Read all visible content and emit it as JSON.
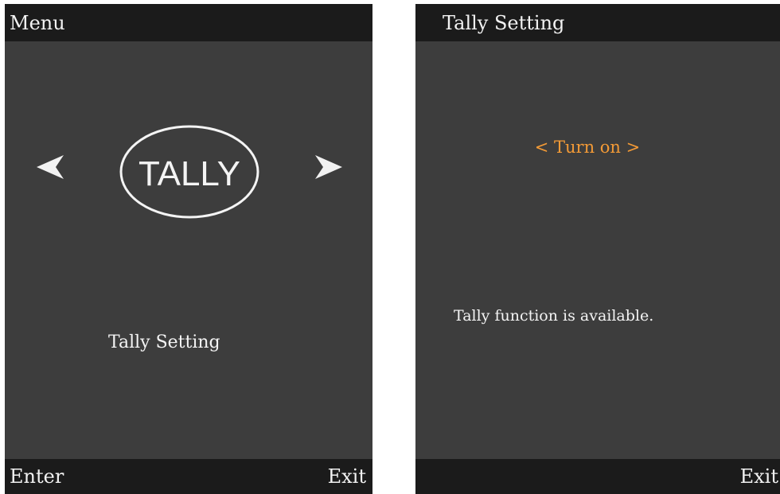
{
  "left_screen": {
    "header_title": "Menu",
    "logo_text": "TALLY",
    "item_label": "Tally Setting",
    "enter_label": "Enter",
    "exit_label": "Exit",
    "icons": [
      "arrow-left-icon",
      "arrow-right-icon",
      "tally-logo-icon"
    ]
  },
  "right_screen": {
    "header_title": "Tally Setting",
    "option_value": "< Turn on >",
    "status_message": "Tally function is available.",
    "exit_label": "Exit"
  },
  "colors": {
    "screen_background": "#3d3d3d",
    "bar_background": "#1b1b1b",
    "text": "#f4f4f4",
    "option_accent": "#f39a36"
  }
}
